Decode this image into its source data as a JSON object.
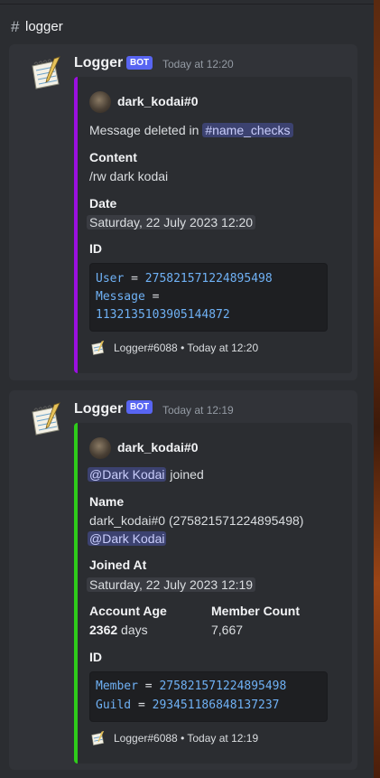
{
  "channel": {
    "hash": "#",
    "name": "logger"
  },
  "colors": {
    "delete_bar": "#9b0fe0",
    "join_bar": "#2ecc1a",
    "accent": "#5865f2"
  },
  "messages": [
    {
      "author": "Logger",
      "tag": "BOT",
      "time": "Today at 12:20",
      "embed": {
        "author": "dark_kodai#0",
        "desc_prefix": "Message deleted in",
        "channel_hash": "#",
        "channel_name": "name_checks",
        "fields": [
          {
            "label": "Content",
            "value": "/rw dark kodai"
          },
          {
            "label": "Date",
            "value": "Saturday, 22 July 2023 12:20"
          },
          {
            "label": "ID"
          }
        ],
        "code": {
          "line1_key": "User",
          "line1_eq": " = ",
          "line1_val": "275821571224895498",
          "line2_key": "Message",
          "line2_eq": " =",
          "line3_val": "1132135103905144872"
        },
        "footer": "Logger#6088 • Today at 12:20"
      }
    },
    {
      "author": "Logger",
      "tag": "BOT",
      "time": "Today at 12:19",
      "embed": {
        "author": "dark_kodai#0",
        "mention": "@Dark Kodai",
        "joined": " joined",
        "name_label": "Name",
        "name_value": "dark_kodai#0 (275821571224895498)",
        "name_mention": "@Dark Kodai",
        "joined_at_label": "Joined At",
        "joined_at_value": "Saturday, 22 July 2023 12:19",
        "account_age_label": "Account Age",
        "account_age_num": "2362",
        "account_age_unit": " days",
        "member_count_label": "Member Count",
        "member_count_value": "7,667",
        "id_label": "ID",
        "code": {
          "line1_key": "Member",
          "line1_eq": " = ",
          "line1_val": "275821571224895498",
          "line2_key": "Guild",
          "line2_eq": " = ",
          "line2_val": "293451186848137237"
        },
        "footer": "Logger#6088 • Today at 12:19"
      }
    }
  ]
}
